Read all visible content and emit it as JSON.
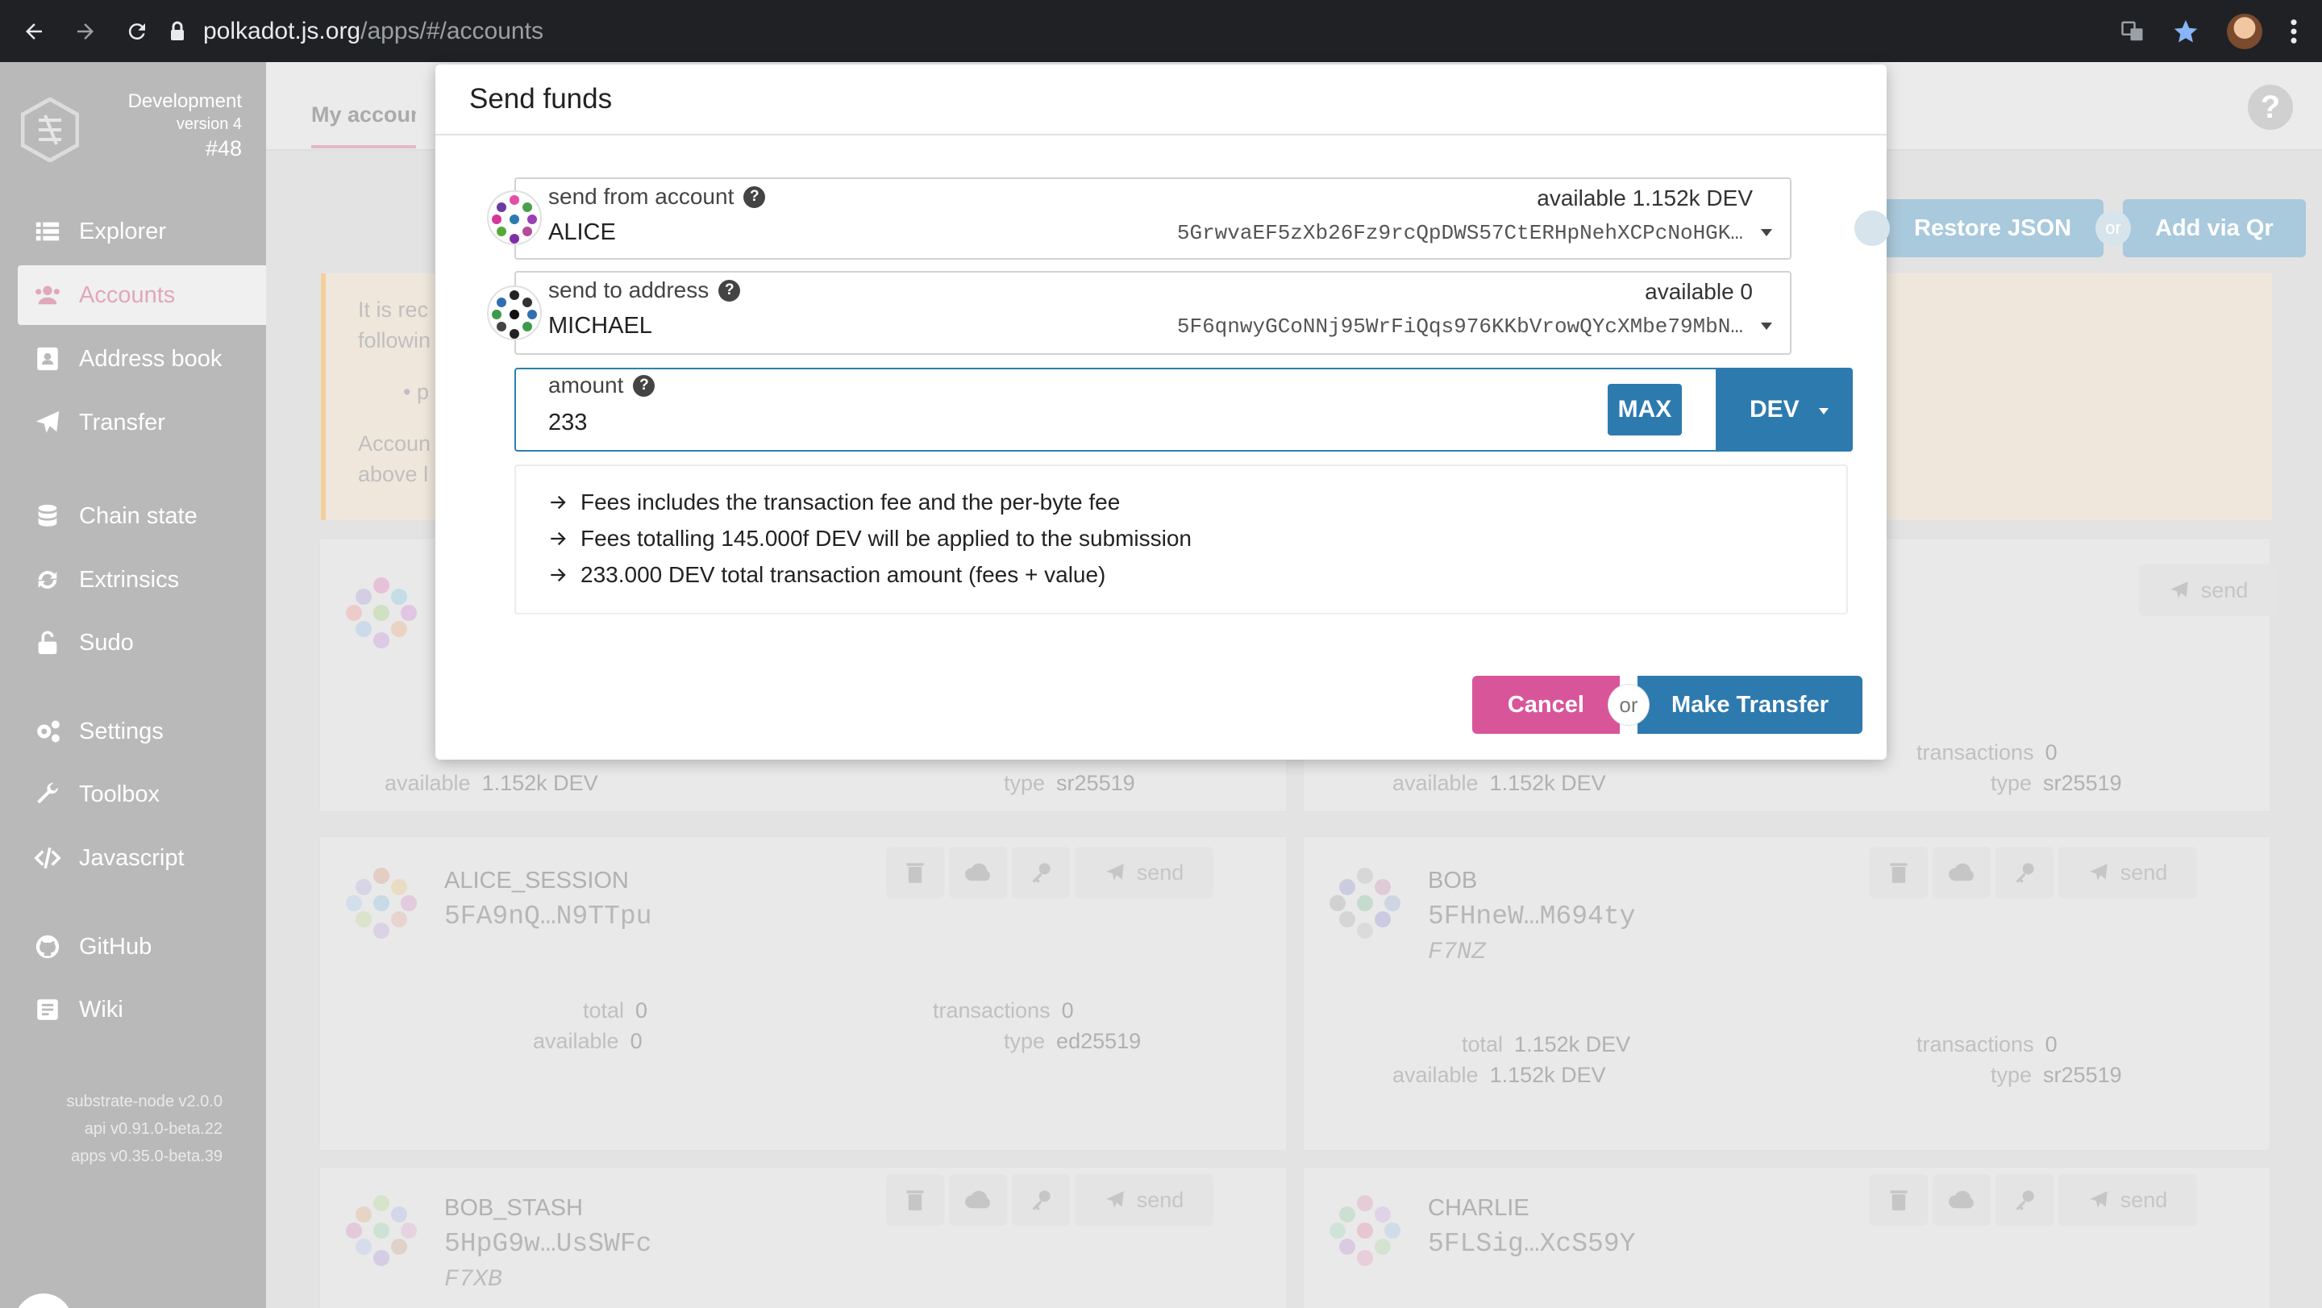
{
  "browser": {
    "url_host": "polkadot.js.org",
    "url_path": "/apps/#/accounts"
  },
  "sidebar": {
    "version": {
      "line1": "Development",
      "line2": "version 4",
      "line3": "#48"
    },
    "items": [
      {
        "label": "Explorer",
        "icon": "explorer-icon"
      },
      {
        "label": "Accounts",
        "icon": "users-icon"
      },
      {
        "label": "Address book",
        "icon": "address-book-icon"
      },
      {
        "label": "Transfer",
        "icon": "paper-plane-icon"
      },
      {
        "label": "Chain state",
        "icon": "database-icon"
      },
      {
        "label": "Extrinsics",
        "icon": "sync-icon"
      },
      {
        "label": "Sudo",
        "icon": "unlock-icon"
      },
      {
        "label": "Settings",
        "icon": "cogs-icon"
      },
      {
        "label": "Toolbox",
        "icon": "wrench-icon"
      },
      {
        "label": "Javascript",
        "icon": "code-icon"
      },
      {
        "label": "GitHub",
        "icon": "github-icon"
      },
      {
        "label": "Wiki",
        "icon": "book-icon"
      }
    ],
    "footer": [
      "substrate-node v2.0.0",
      "api v0.91.0-beta.22",
      "apps v0.35.0-beta.39"
    ],
    "collapse_label": "«"
  },
  "page": {
    "tab_label": "My accounts",
    "help": "?",
    "restore_json": "Restore JSON",
    "or": "or",
    "add_via_qr": "Add via Qr",
    "notice": {
      "line1": "It is rec",
      "line2": "followin",
      "line3": "• p",
      "line4": "Accoun",
      "line5": "above l"
    },
    "send_label": "send",
    "labels": {
      "total": "total",
      "available": "available",
      "transactions": "transactions",
      "type": "type"
    },
    "row1_left": {
      "available": "1.152k DEV",
      "type": "sr25519"
    },
    "row1_right": {
      "available": "1.152k DEV",
      "transactions": "0",
      "type": "sr25519"
    },
    "accounts": [
      {
        "name": "ALICE_SESSION",
        "address": "5FA9nQ…N9TTpu",
        "total": "0",
        "available": "0",
        "transactions": "0",
        "type": "ed25519"
      },
      {
        "name": "BOB",
        "address": "5FHneW…M694ty",
        "sub": "F7NZ",
        "total": "1.152k DEV",
        "available": "1.152k DEV",
        "transactions": "0",
        "type": "sr25519"
      },
      {
        "name": "BOB_STASH",
        "address": "5HpG9w…UsSWFc",
        "sub": "F7XB"
      },
      {
        "name": "CHARLIE",
        "address": "5FLSig…XcS59Y"
      }
    ]
  },
  "modal": {
    "title": "Send funds",
    "from": {
      "label": "send from account",
      "name": "ALICE",
      "available": "available 1.152k DEV",
      "address": "5GrwvaEF5zXb26Fz9rcQpDWS57CtERHpNehXCPcNoHGK…"
    },
    "to": {
      "label": "send to address",
      "name": "MICHAEL",
      "available": "available 0",
      "address": "5F6qnwyGCoNNj95WrFiQqs976KKbVrowQYcXMbe79MbN…"
    },
    "amount": {
      "label": "amount",
      "value": "233",
      "max": "MAX",
      "unit": "DEV"
    },
    "fees": [
      "Fees includes the transaction fee and the per-byte fee",
      "Fees totalling 145.000f DEV will be applied to the submission",
      "233.000 DEV total transaction amount (fees + value)"
    ],
    "cancel": "Cancel",
    "or": "or",
    "submit": "Make Transfer"
  },
  "colors": {
    "accent_blue": "#2d7aaf",
    "cancel_pink": "#d9559a",
    "sidebar": "#b9b9b9"
  }
}
